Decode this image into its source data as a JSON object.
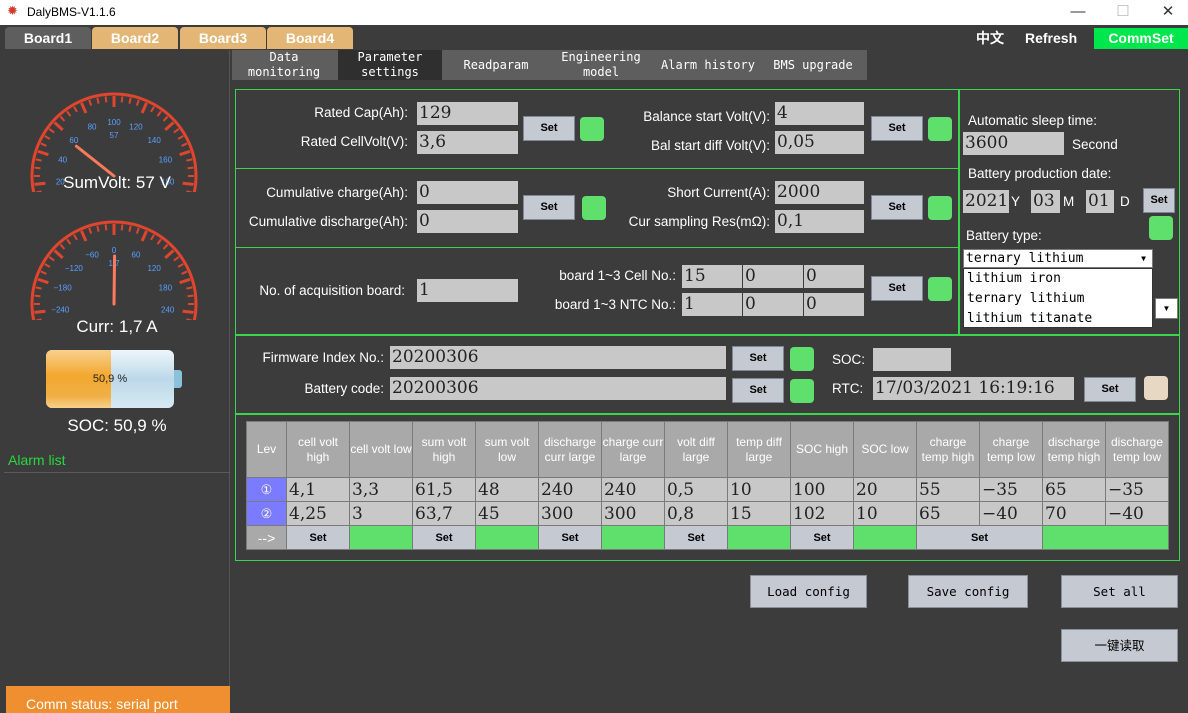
{
  "window": {
    "title": "DalyBMS-V1.1.6",
    "minimize": "—",
    "maximize": "☐",
    "close": "✕"
  },
  "boards": [
    "Board1",
    "Board2",
    "Board3",
    "Board4"
  ],
  "header": {
    "lang": "中文",
    "refresh": "Refresh",
    "commset": "CommSet"
  },
  "gauges": {
    "sumvolt": {
      "label": "SumVolt: 57 V",
      "ticks": [
        "0",
        "20",
        "40",
        "60",
        "80",
        "100",
        "120",
        "140",
        "160",
        "180",
        "200"
      ],
      "center_tick": "57",
      "min": 0,
      "max": 200,
      "value": 57
    },
    "curr": {
      "label": "Curr: 1,7 A",
      "ticks": [
        "−300",
        "−240",
        "−180",
        "−120",
        "−60",
        "0",
        "60",
        "120",
        "180",
        "240",
        "300"
      ],
      "center_tick": "1,7",
      "min": -300,
      "max": 300,
      "value": 1.7
    }
  },
  "battery": {
    "text": "50,9 %",
    "percent": 50.9
  },
  "soc_label": "SOC: 50,9 %",
  "alarm_list_label": "Alarm list",
  "comm_status": "Comm status: serial port",
  "page_tabs": [
    "Data monitoring",
    "Parameter settings",
    "Readparam",
    "Engineering model",
    "Alarm history",
    "BMS upgrade"
  ],
  "set_label": "Set",
  "p1": {
    "rated_cap_label": "Rated Cap(Ah):",
    "rated_cap": "129",
    "rated_cellvolt_label": "Rated CellVolt(V):",
    "rated_cellvolt": "3,6",
    "bal_start_volt_label": "Balance start Volt(V):",
    "bal_start_volt": "4",
    "bal_diff_label": "Bal start diff Volt(V):",
    "bal_diff": "0,05"
  },
  "p2": {
    "cum_charge_label": "Cumulative charge(Ah):",
    "cum_charge": "0",
    "cum_discharge_label": "Cumulative discharge(Ah):",
    "cum_discharge": "0",
    "short_current_label": "Short Current(A):",
    "short_current": "2000",
    "cur_res_label": "Cur sampling Res(mΩ):",
    "cur_res": "0,1"
  },
  "p3": {
    "acq_label": "No. of acquisition board:",
    "acq": "1",
    "cell_no_label": "board 1~3 Cell No.:",
    "cell_no": [
      "15",
      "0",
      "0"
    ],
    "ntc_no_label": "board 1~3 NTC No.:",
    "ntc_no": [
      "1",
      "0",
      "0"
    ]
  },
  "right": {
    "sleep_label": "Automatic sleep time:",
    "sleep": "3600",
    "sleep_unit": "Second",
    "prod_label": "Battery production date:",
    "year": "2021",
    "year_unit": "Y",
    "month": "03",
    "month_unit": "M",
    "day": "01",
    "day_unit": "D",
    "type_label": "Battery type:",
    "type_selected": "ternary lithium",
    "type_options": [
      "lithium iron",
      "ternary lithium",
      "lithium titanate"
    ]
  },
  "p4": {
    "fw_label": "Firmware Index No.:",
    "fw": "20200306",
    "code_label": "Battery code:",
    "code": "20200306",
    "soc_label": "SOC:",
    "soc": "",
    "rtc_label": "RTC:",
    "rtc": "17/03/2021 16:19:16"
  },
  "alarm_table": {
    "headers": [
      "Lev",
      "cell volt high",
      "cell volt low",
      "sum volt high",
      "sum volt low",
      "discharge curr large",
      "charge curr large",
      "volt diff large",
      "temp diff large",
      "SOC high",
      "SOC low",
      "charge temp high",
      "charge temp low",
      "discharge temp high",
      "discharge temp low"
    ],
    "rows": [
      {
        "lev": "①",
        "values": [
          "4,1",
          "3,3",
          "61,5",
          "48",
          "240",
          "240",
          "0,5",
          "10",
          "100",
          "20",
          "55",
          "−35",
          "65",
          "−35"
        ]
      },
      {
        "lev": "②",
        "values": [
          "4,25",
          "3",
          "63,7",
          "45",
          "300",
          "300",
          "0,8",
          "15",
          "102",
          "10",
          "65",
          "−40",
          "70",
          "−40"
        ]
      }
    ],
    "action_lead": "-->"
  },
  "buttons": {
    "load": "Load config",
    "save": "Save config",
    "setall": "Set all",
    "readall": "一键读取"
  },
  "colors": {
    "accent_green": "#00e64d",
    "led_green": "#5fe06c",
    "board_tab": "#e3b676",
    "comm_status": "#ef8f2f",
    "alarm_label": "#29d940"
  }
}
